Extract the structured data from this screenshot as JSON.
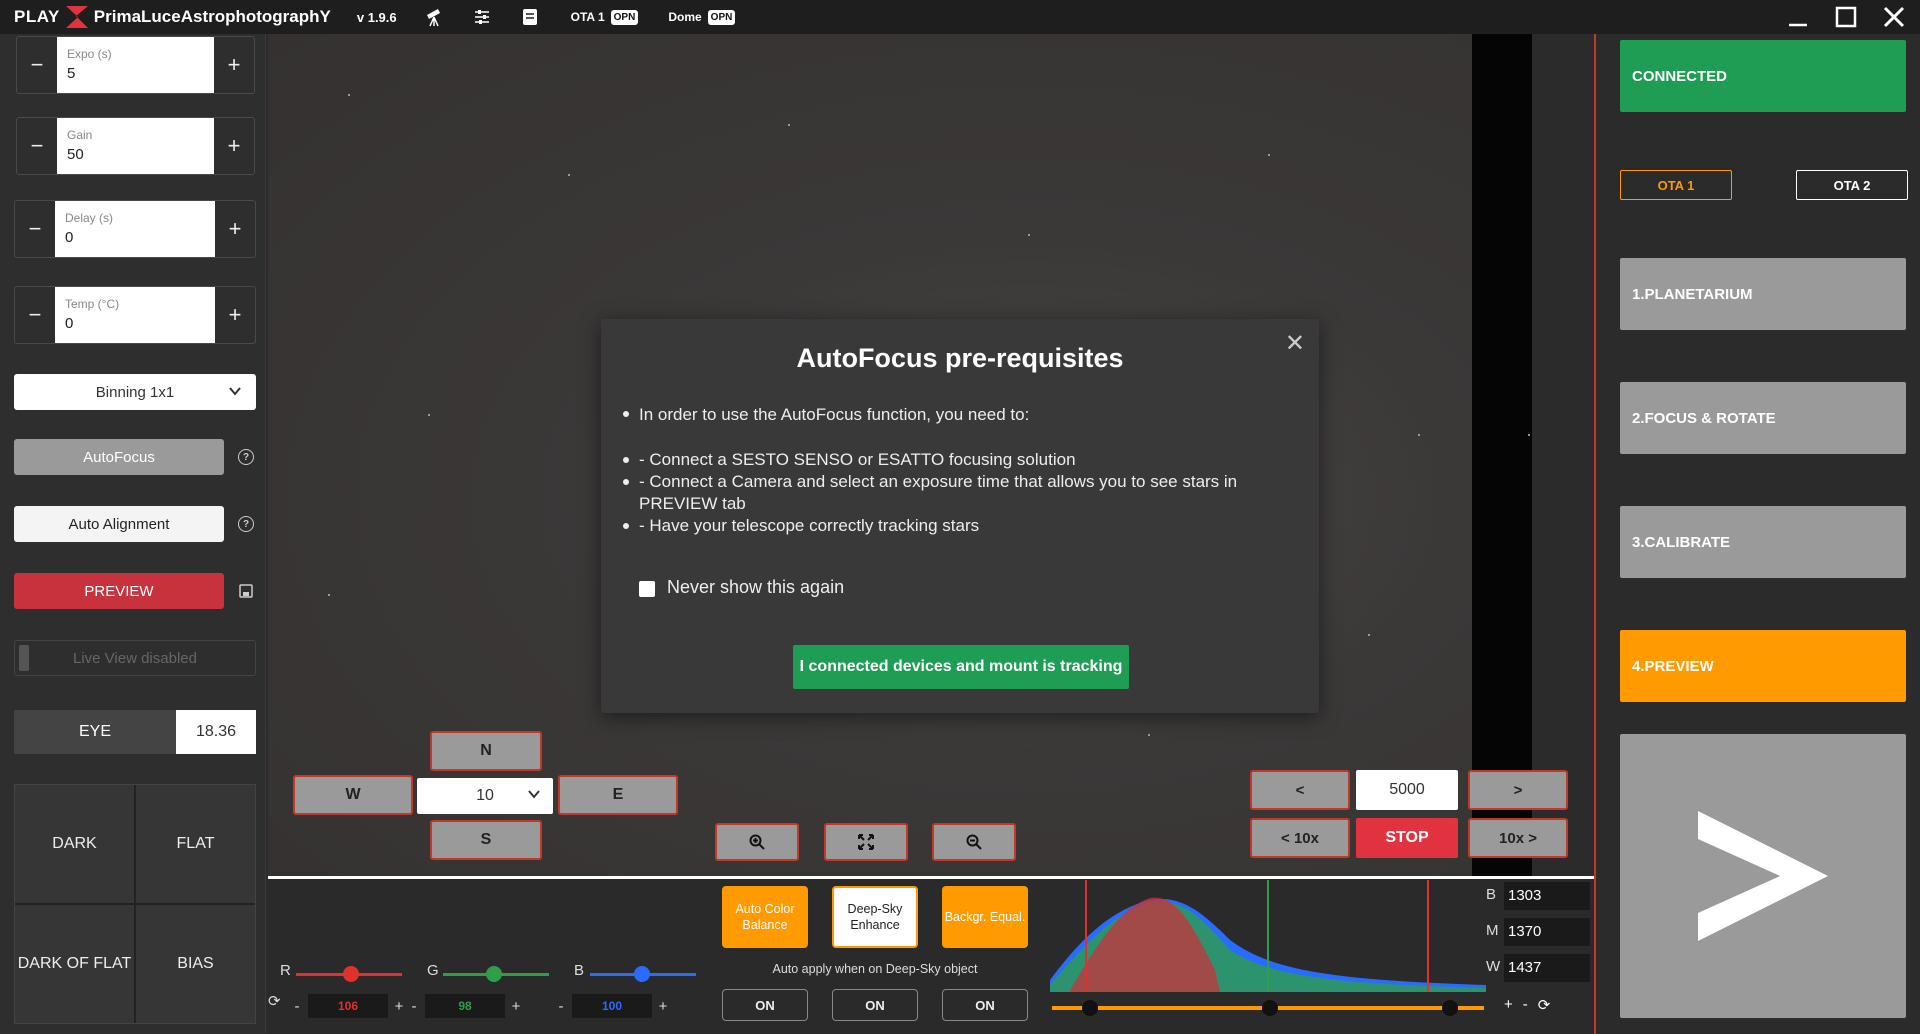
{
  "titlebar": {
    "play": "PLAY",
    "brand": "PrimaLuceAstrophotographY",
    "version": "v 1.9.6",
    "ota_label": "OTA 1",
    "ota_badge": "OPN",
    "dome_label": "Dome",
    "dome_badge": "OPN"
  },
  "camera": {
    "expo": {
      "label": "Expo (s)",
      "value": "5"
    },
    "gain": {
      "label": "Gain",
      "value": "50"
    },
    "delay": {
      "label": "Delay (s)",
      "value": "0"
    },
    "temp": {
      "label": "Temp (°C)",
      "value": "0"
    },
    "binning": "Binning 1x1",
    "autofocus": "AutoFocus",
    "auto_alignment": "Auto Alignment",
    "preview": "PREVIEW",
    "live_view": "Live View disabled",
    "eye_label": "EYE",
    "eye_value": "18.36",
    "calib": [
      "DARK",
      "FLAT",
      "DARK OF FLAT",
      "BIAS"
    ]
  },
  "modal": {
    "title": "AutoFocus pre-requisites",
    "lead": "In order to use the AutoFocus function, you need to:",
    "items": [
      "- Connect a SESTO SENSO or ESATTO focusing solution",
      "- Connect a Camera and select an exposure time that allows you to see stars in PREVIEW tab",
      "- Have your telescope correctly tracking stars"
    ],
    "checkbox": "Never show this again",
    "confirm": "I connected devices and mount is tracking"
  },
  "mount": {
    "north": "N",
    "south": "S",
    "west": "W",
    "east": "E",
    "speed": "10"
  },
  "focuser": {
    "prev": "<",
    "next": ">",
    "position": "5000",
    "prev10": "< 10x",
    "next10": "10x >",
    "stop": "STOP"
  },
  "color": {
    "r_label": "R",
    "g_label": "G",
    "b_label": "B",
    "r_value": "106",
    "g_value": "98",
    "b_value": "100",
    "r_level": 0.52,
    "g_level": 0.48,
    "b_level": 0.49,
    "minus": "-",
    "plus": "+",
    "auto_color": "Auto Color Balance",
    "deep_sky": "Deep-Sky Enhance",
    "background": "Backgr. Equal.",
    "auto_apply": "Auto apply when on Deep-Sky object",
    "on": "ON"
  },
  "levels": {
    "b_label": "B",
    "b_value": "1303",
    "m_label": "M",
    "m_value": "1370",
    "w_label": "W",
    "w_value": "1437",
    "plus": "+",
    "minus": "-"
  },
  "sidebar": {
    "connected": "CONNECTED",
    "ota1": "OTA 1",
    "ota2": "OTA 2",
    "steps": [
      "1.PLANETARIUM",
      "2.FOCUS & ROTATE",
      "3.CALIBRATE",
      "4.PREVIEW"
    ]
  },
  "colors": {
    "accent": "#ff9a00",
    "connected": "#1f9d55",
    "stop": "#e1323f",
    "red_slider": "#e03030",
    "green_slider": "#2e9e4a",
    "blue_slider": "#2a6bff"
  }
}
